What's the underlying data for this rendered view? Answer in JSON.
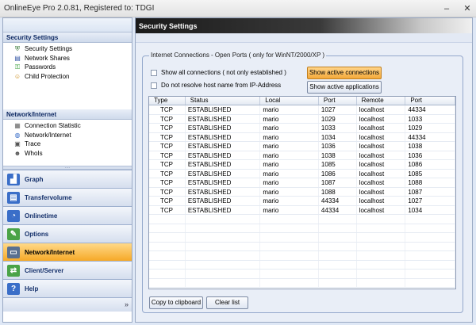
{
  "window": {
    "title": "OnlineEye Pro 2.0.81, Registered to: TDGI"
  },
  "left": {
    "security": {
      "header": "Security Settings",
      "items": [
        {
          "label": "Security Settings",
          "icon": "shield-icon"
        },
        {
          "label": "Network Shares",
          "icon": "share-icon"
        },
        {
          "label": "Passwords",
          "icon": "key-icon"
        },
        {
          "label": "Child Protection",
          "icon": "child-icon"
        }
      ]
    },
    "network": {
      "header": "Network/Internet",
      "items": [
        {
          "label": "Connection Statistic",
          "icon": "stats-icon"
        },
        {
          "label": "Network/Internet",
          "icon": "globe-icon"
        },
        {
          "label": "Trace",
          "icon": "trace-icon"
        },
        {
          "label": "WhoIs",
          "icon": "person-icon"
        }
      ]
    },
    "nav": [
      {
        "label": "Graph",
        "icon": "graph-icon",
        "color": "#3a6ec8"
      },
      {
        "label": "Transfervolume",
        "icon": "transfer-icon",
        "color": "#3a6ec8"
      },
      {
        "label": "Onlinetime",
        "icon": "clock-icon",
        "color": "#3a6ec8"
      },
      {
        "label": "Options",
        "icon": "options-icon",
        "color": "#4aa347"
      },
      {
        "label": "Network/Internet",
        "icon": "network-icon",
        "color": "#5a7090",
        "active": true
      },
      {
        "label": "Client/Server",
        "icon": "client-server-icon",
        "color": "#4aa347"
      },
      {
        "label": "Help",
        "icon": "help-icon",
        "color": "#3a6ec8"
      }
    ]
  },
  "main": {
    "header": "Security Settings",
    "group_label": "Internet Connections - Open Ports ( only for WinNT/2000/XP )",
    "checkbox_all": "Show all connections ( not only established )",
    "checkbox_resolve": "Do not resolve host name from IP-Address",
    "btn_active_connections": "Show active connections",
    "btn_active_applications": "Show active applications",
    "columns": [
      "Type",
      "Status",
      "Local",
      "Port",
      "Remote",
      "Port"
    ],
    "rows": [
      [
        "TCP",
        "ESTABLISHED",
        "mario",
        "1027",
        "localhost",
        "44334"
      ],
      [
        "TCP",
        "ESTABLISHED",
        "mario",
        "1029",
        "localhost",
        "1033"
      ],
      [
        "TCP",
        "ESTABLISHED",
        "mario",
        "1033",
        "localhost",
        "1029"
      ],
      [
        "TCP",
        "ESTABLISHED",
        "mario",
        "1034",
        "localhost",
        "44334"
      ],
      [
        "TCP",
        "ESTABLISHED",
        "mario",
        "1036",
        "localhost",
        "1038"
      ],
      [
        "TCP",
        "ESTABLISHED",
        "mario",
        "1038",
        "localhost",
        "1036"
      ],
      [
        "TCP",
        "ESTABLISHED",
        "mario",
        "1085",
        "localhost",
        "1086"
      ],
      [
        "TCP",
        "ESTABLISHED",
        "mario",
        "1086",
        "localhost",
        "1085"
      ],
      [
        "TCP",
        "ESTABLISHED",
        "mario",
        "1087",
        "localhost",
        "1088"
      ],
      [
        "TCP",
        "ESTABLISHED",
        "mario",
        "1088",
        "localhost",
        "1087"
      ],
      [
        "TCP",
        "ESTABLISHED",
        "mario",
        "44334",
        "localhost",
        "1027"
      ],
      [
        "TCP",
        "ESTABLISHED",
        "mario",
        "44334",
        "localhost",
        "1034"
      ]
    ],
    "btn_copy": "Copy to clipboard",
    "btn_clear": "Clear list"
  }
}
